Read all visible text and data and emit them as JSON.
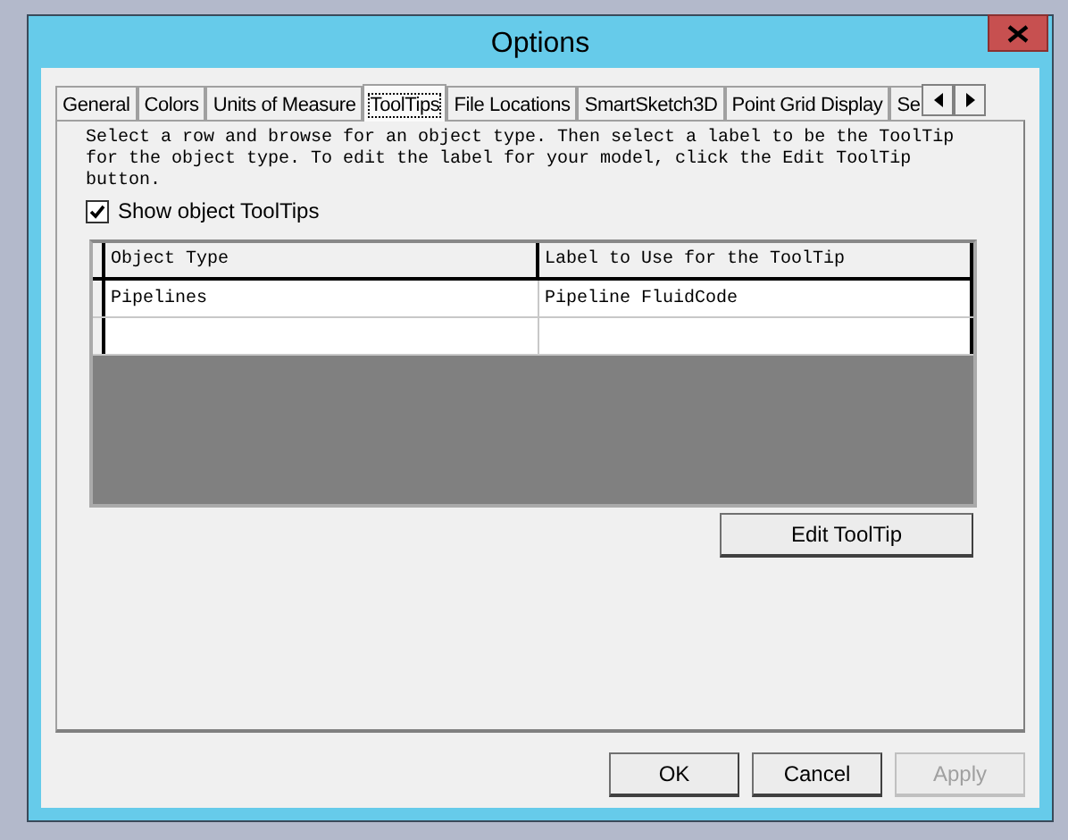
{
  "window": {
    "title": "Options"
  },
  "tabs": [
    {
      "label": "General",
      "selected": false
    },
    {
      "label": "Colors",
      "selected": false
    },
    {
      "label": "Units of Measure",
      "selected": false
    },
    {
      "label": "ToolTips",
      "selected": true
    },
    {
      "label": "File Locations",
      "selected": false
    },
    {
      "label": "SmartSketch3D",
      "selected": false
    },
    {
      "label": "Point Grid Display",
      "selected": false
    },
    {
      "label": "Se",
      "selected": false
    }
  ],
  "instructions": "Select a row and browse for an object type. Then select a label to be the ToolTip for the object type. To edit the label for your model, click the Edit ToolTip button.",
  "show_tooltips": {
    "label": "Show object ToolTips",
    "checked": true
  },
  "table": {
    "columns": [
      "Object Type",
      "Label to Use for the ToolTip"
    ],
    "rows": [
      [
        "Pipelines",
        "Pipeline FluidCode"
      ],
      [
        "",
        ""
      ]
    ]
  },
  "edit_button": "Edit ToolTip",
  "buttons": [
    {
      "label": "OK",
      "disabled": false
    },
    {
      "label": "Cancel",
      "disabled": false
    },
    {
      "label": "Apply",
      "disabled": true
    }
  ]
}
